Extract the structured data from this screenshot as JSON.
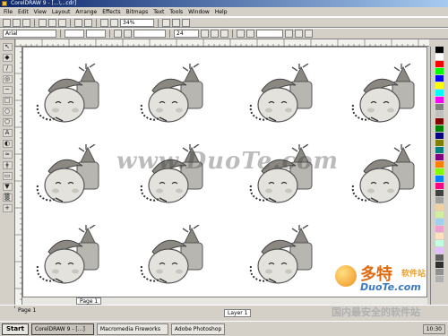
{
  "window": {
    "title": "CorelDRAW 9 - [...\\...cdr]"
  },
  "menu": [
    "File",
    "Edit",
    "View",
    "Layout",
    "Arrange",
    "Effects",
    "Bitmaps",
    "Text",
    "Tools",
    "Window",
    "Help"
  ],
  "toolbar": {
    "zoom_value": "34%",
    "font_value": "Arial",
    "font_size": "24"
  },
  "canvas": {
    "watermark": "www.DuoTe.com"
  },
  "status": {
    "left_text": "Page 1",
    "page_tab": "Page 1",
    "mid_text": "Layer 1"
  },
  "palette_colors": [
    "#000000",
    "#ffffff",
    "#ff0000",
    "#00ff00",
    "#0000ff",
    "#ffff00",
    "#00ffff",
    "#ff00ff",
    "#808080",
    "#c0c0c0",
    "#800000",
    "#008000",
    "#000080",
    "#808000",
    "#008080",
    "#800080",
    "#ff8000",
    "#80ff00",
    "#0080ff",
    "#ff0080",
    "#404040",
    "#a0a0a0",
    "#f0d0a0",
    "#d0f0a0",
    "#a0d0f0",
    "#f0a0d0",
    "#ffe0c0",
    "#c0ffe0",
    "#e0c0ff",
    "#606060",
    "#303030",
    "#909090",
    "#b0b0b0"
  ],
  "taskbar": {
    "start": "Start",
    "tasks": [
      "CorelDRAW 9 - [...]",
      "Macromedia Fireworks",
      "Adobe Photoshop"
    ],
    "clock": "10:30"
  },
  "logo": {
    "brand": "多特",
    "brand_sub": "软件站",
    "site": "DuoTe.com",
    "tagline": "国内最安全的软件站"
  }
}
